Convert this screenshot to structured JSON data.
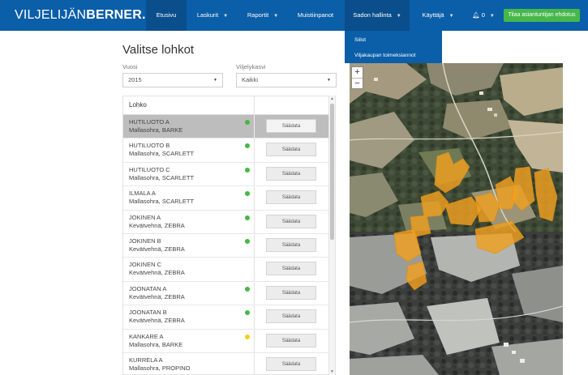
{
  "brand": {
    "part1": "VILJELIJÄN",
    "part2": "BERNER.FI"
  },
  "nav": {
    "items": [
      {
        "label": "Etusivu"
      },
      {
        "label": "Laskurit"
      },
      {
        "label": "Raportit"
      },
      {
        "label": "Muistiinpanot"
      },
      {
        "label": "Sadon hallinta"
      },
      {
        "label": "Käyttäjä"
      }
    ],
    "notifications": "0",
    "cta": "Tilaa asiantuntijan ehdotus"
  },
  "dropdown": {
    "items": [
      "Siilot",
      "Viljakaupan toimeksiannot"
    ]
  },
  "page": {
    "title": "Valitse lohkot",
    "year_label": "Vuosi",
    "year_value": "2015",
    "crop_label": "Viljelykasvi",
    "crop_value": "Kaikki"
  },
  "table": {
    "header": "Lohko",
    "rows": [
      {
        "name": "HUTILUOTO A",
        "crop": "Mallasohra, BARKE",
        "status": "green",
        "action": "Säädata",
        "selected": true
      },
      {
        "name": "HUTILUOTO B",
        "crop": "Mallasohra, SCARLETT",
        "status": "green",
        "action": "Säädata"
      },
      {
        "name": "HUTILUOTO C",
        "crop": "Mallasohra, SCARLETT",
        "status": "green",
        "action": "Säädata"
      },
      {
        "name": "ILMALA A",
        "crop": "Mallasohra, SCARLETT",
        "status": "green",
        "action": "Säädata"
      },
      {
        "name": "JOKINEN A",
        "crop": "Kevätvehnä, ZEBRA",
        "status": "green",
        "action": "Säädata"
      },
      {
        "name": "JOKINEN B",
        "crop": "Kevätvehnä, ZEBRA",
        "status": "green",
        "action": "Säädata"
      },
      {
        "name": "JOKINEN C",
        "crop": "Kevätvehnä, ZEBRA",
        "status": "none",
        "action": "Säädata"
      },
      {
        "name": "JOONATAN A",
        "crop": "Kevätvehnä, ZEBRA",
        "status": "green",
        "action": "Säädata"
      },
      {
        "name": "JOONATAN B",
        "crop": "Kevätvehnä, ZEBRA",
        "status": "green",
        "action": "Säädata"
      },
      {
        "name": "KANKARE A",
        "crop": "Mallasohra, BARKE",
        "status": "yellow",
        "action": "Säädata"
      },
      {
        "name": "KURRELA A",
        "crop": "Mallasohra, PROPINO",
        "status": "none",
        "action": "Säädata"
      }
    ]
  },
  "map": {
    "zoom_in": "+",
    "zoom_out": "−"
  },
  "colors": {
    "nav": "#0b5ea8",
    "cta": "#46b84a",
    "status_green": "#45b843",
    "status_yellow": "#f0d21e",
    "field": "#f0a020"
  }
}
